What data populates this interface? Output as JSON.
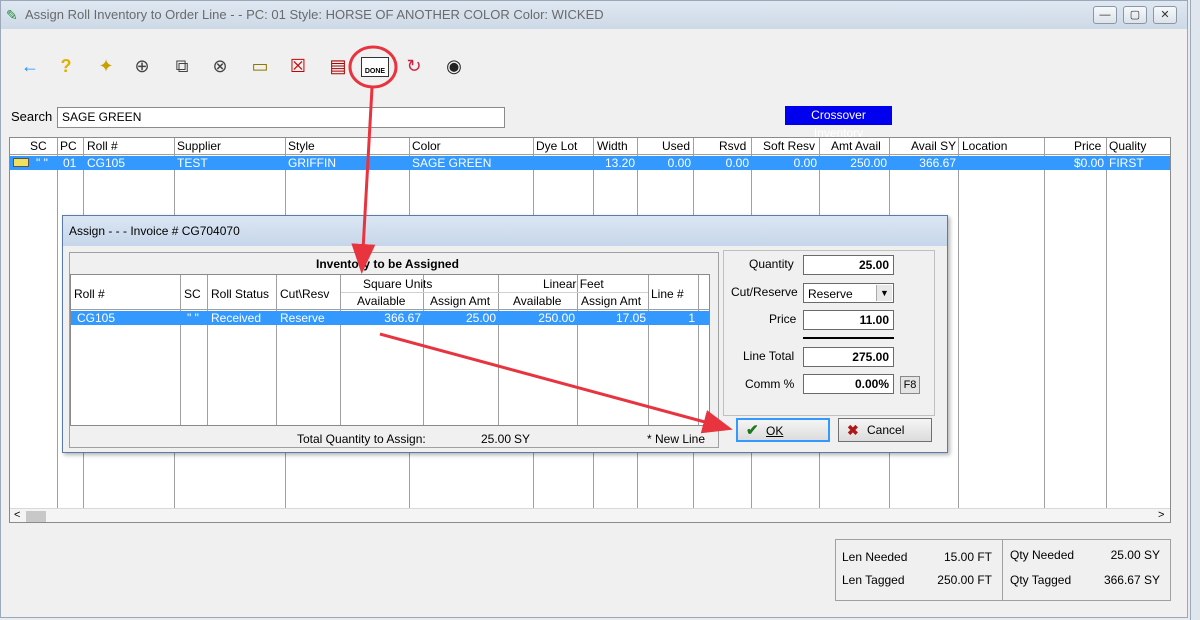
{
  "window": {
    "title": "Assign Roll Inventory to Order Line - -   PC: 01   Style: HORSE OF ANOTHER COLOR   Color: WICKED",
    "minimize": "—",
    "maximize": "▢",
    "close": "✕"
  },
  "toolbar": {
    "back": "←",
    "help": "?",
    "bulb": "✦",
    "add": "⊕",
    "copy": "⧉",
    "delete": "⊗",
    "tag": "▭",
    "tag_delete": "☒",
    "book": "▤",
    "done": "DONE",
    "refresh": "↻",
    "find": "◉"
  },
  "search": {
    "label": "Search",
    "value": "SAGE GREEN"
  },
  "crossover_label": "Crossover Inventory",
  "grid": {
    "headers": [
      "SC",
      "PC",
      "Roll #",
      "Supplier",
      "Style",
      "Color",
      "Dye Lot",
      "Width",
      "Used",
      "Rsvd",
      "Soft Resv",
      "Amt Avail",
      "Avail SY",
      "Location",
      "Price",
      "Quality"
    ],
    "row": [
      "\" \"",
      "01",
      "CG105",
      "TEST",
      "GRIFFIN",
      "SAGE GREEN",
      "",
      "13.20",
      "0.00",
      "0.00",
      "0.00",
      "250.00",
      "366.67",
      "",
      "$0.00",
      "FIRST"
    ],
    "scroll_left": "<",
    "scroll_right": ">"
  },
  "summary": {
    "len_needed_label": "Len Needed",
    "len_needed": "15.00 FT",
    "len_tagged_label": "Len Tagged",
    "len_tagged": "250.00 FT",
    "qty_needed_label": "Qty Needed",
    "qty_needed": "25.00 SY",
    "qty_tagged_label": "Qty Tagged",
    "qty_tagged": "366.67 SY"
  },
  "dialog": {
    "title": "Assign - - -   Invoice # CG704070",
    "section_title": "Inventory to be Assigned",
    "group_square": "Square Units",
    "group_linear": "Linear Feet",
    "headers": [
      "Roll #",
      "SC",
      "Roll Status",
      "Cut\\Resv",
      "Available",
      "Assign Amt",
      "Available",
      "Assign Amt",
      "Line #"
    ],
    "row": [
      "CG105",
      "\" \"",
      "Received",
      "Reserve",
      "366.67",
      "25.00",
      "250.00",
      "17.05",
      "1"
    ],
    "total_label": "Total Quantity to Assign:",
    "total_value": "25.00",
    "total_unit": "SY",
    "new_line_note": "* New Line",
    "quantity_label": "Quantity",
    "quantity": "25.00",
    "cut_reserve_label": "Cut/Reserve",
    "cut_reserve": "Reserve",
    "price_label": "Price",
    "price": "11.00",
    "line_total_label": "Line Total",
    "line_total": "275.00",
    "comm_label": "Comm %",
    "comm": "0.00%",
    "f8": "F8",
    "ok": "OK",
    "cancel": "Cancel"
  },
  "colors": {
    "selection": "#3399ff",
    "crossover": "#0000ee",
    "annotation": "#e8343f"
  }
}
